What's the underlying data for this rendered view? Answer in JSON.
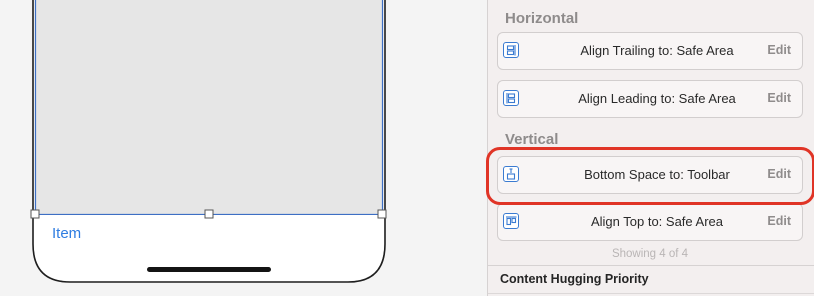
{
  "canvas": {
    "toolbar_item_label": "Item"
  },
  "inspector": {
    "horizontal_label": "Horizontal",
    "vertical_label": "Vertical",
    "constraints": [
      {
        "label": "Align Trailing to:  Safe Area",
        "edit": "Edit",
        "icon": "align-trailing-icon"
      },
      {
        "label": "Align Leading to:  Safe Area",
        "edit": "Edit",
        "icon": "align-leading-icon"
      },
      {
        "label": "Bottom Space to:  Toolbar",
        "edit": "Edit",
        "icon": "bottom-space-icon"
      },
      {
        "label": "Align Top to:  Safe Area",
        "edit": "Edit",
        "icon": "align-top-icon"
      }
    ],
    "showing": "Showing 4 of 4",
    "content_hugging_label": "Content Hugging Priority"
  },
  "colors": {
    "highlight": "#e03426",
    "accent": "#3b7bd1",
    "toolbar_item": "#2f7de1"
  }
}
